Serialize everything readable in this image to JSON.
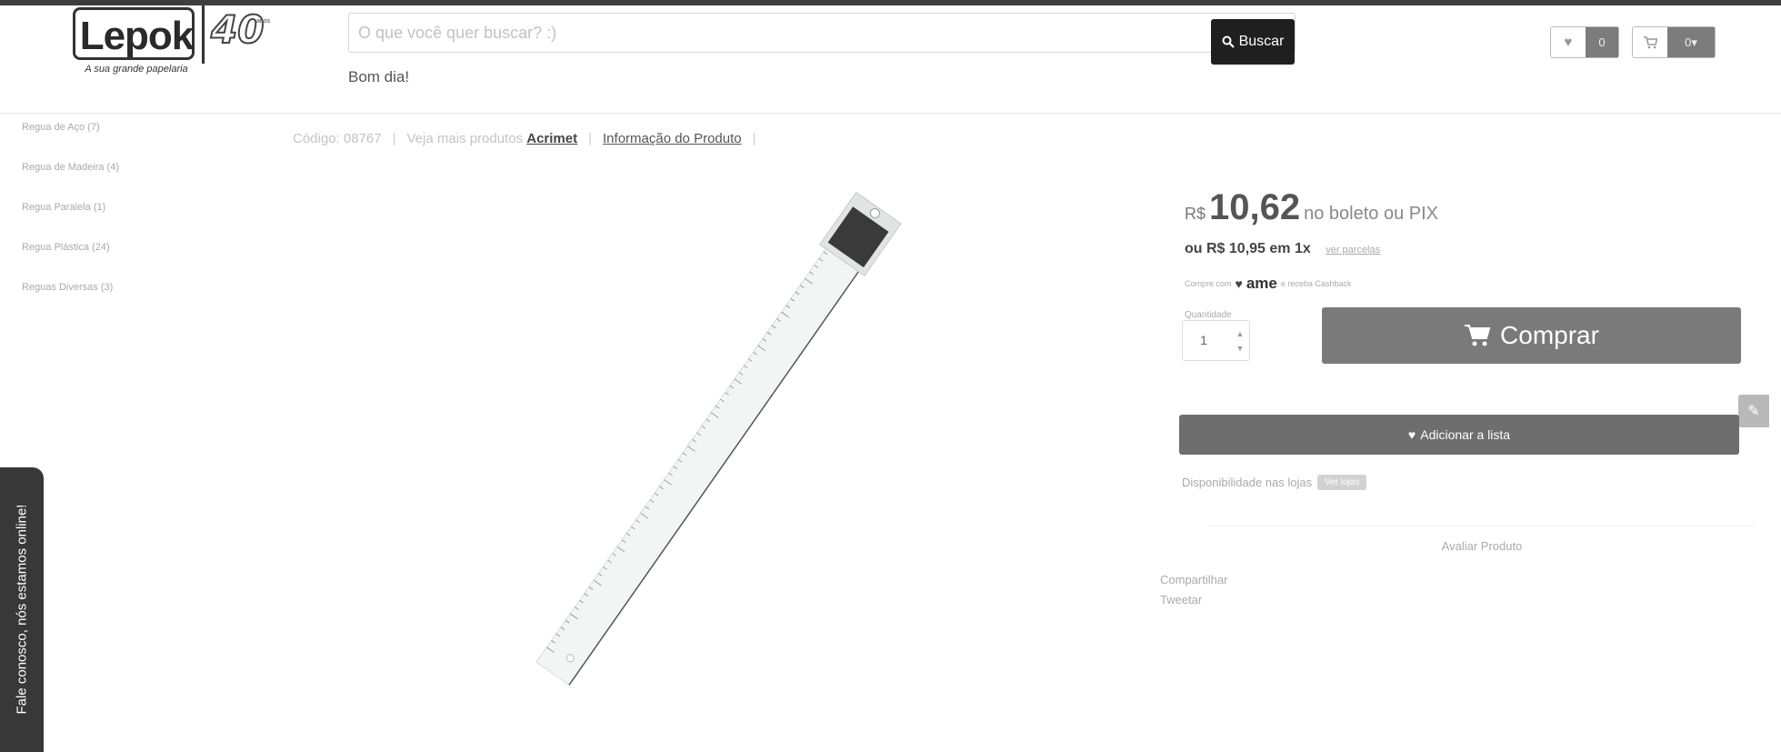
{
  "header": {
    "logo_word": "Lepok",
    "logo_anniversary": "40",
    "logo_anniversary_suffix": "anos",
    "logo_tagline": "A sua grande papelaria",
    "search_placeholder": "O que você quer buscar? :)",
    "search_button": "Buscar",
    "greeting": "Bom dia!",
    "wishlist_count": "0",
    "cart_count": "0▾"
  },
  "sidebar": {
    "categories": [
      "Regua de Aço (7)",
      "Regua de Madeira (4)",
      "Regua Paralela (1)",
      "Regua Plástica (24)",
      "Reguas Diversas (3)"
    ]
  },
  "product_info": {
    "code": "Código: 08767",
    "more_products": "Veja mais produtos",
    "brand": "Acrimet",
    "product_info_link": "Informação do Produto"
  },
  "price": {
    "currency": "R$",
    "amount": "10,62",
    "method": "no boleto ou PIX",
    "installment": "ou R$ 10,95 em 1x",
    "see_installments": "ver parcelas",
    "ame_prefix": "Compre com",
    "ame_brand": "ame",
    "ame_suffix": "e receba Cashback"
  },
  "purchase": {
    "quantity_label": "Quantidade",
    "quantity_value": "1",
    "buy_button": "Comprar",
    "add_to_list_button": "Adicionar a lista",
    "availability": "Disponibilidade nas lojas",
    "availability_badge": "Ver lojas",
    "rate_button": "Avaliar Produto",
    "share": "Compartilhar",
    "tweet": "Tweetar"
  },
  "chat": {
    "label": "Fale conosco, nós estamos online!"
  },
  "icons": {
    "search": "search-icon",
    "heart": "heart-icon",
    "cart": "cart-icon",
    "edit": "pencil-icon"
  },
  "colors": {
    "topbar": "#3e3e3e",
    "search_button": "#1f1f1f",
    "buy_button": "#7a7a7a",
    "list_button": "#6e6e6e",
    "chat_tab": "#383838"
  }
}
